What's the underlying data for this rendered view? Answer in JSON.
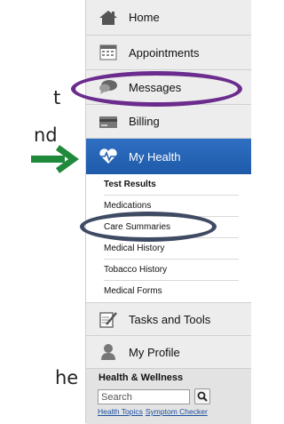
{
  "background_text": {
    "frag1": "t",
    "frag2": "nd",
    "frag3": "he"
  },
  "sidebar": {
    "items": [
      {
        "label": "Home",
        "icon": "home-icon"
      },
      {
        "label": "Appointments",
        "icon": "calendar-icon"
      },
      {
        "label": "Messages",
        "icon": "speech-bubble-icon"
      },
      {
        "label": "Billing",
        "icon": "billing-card-icon"
      },
      {
        "label": "My Health",
        "icon": "heart-pulse-icon"
      },
      {
        "label": "Tasks and Tools",
        "icon": "clipboard-pencil-icon"
      },
      {
        "label": "My Profile",
        "icon": "person-icon"
      }
    ],
    "health_submenu": [
      "Test Results",
      "Medications",
      "Care Summaries",
      "Medical History",
      "Tobacco History",
      "Medical Forms"
    ]
  },
  "health_wellness": {
    "title": "Health & Wellness",
    "search_value": "Search",
    "links": [
      "Health Topics",
      "Symptom Checker"
    ]
  },
  "colors": {
    "active_item": "#2563b0",
    "arrow": "#1f8a3b",
    "messages_highlight": "#6b2c8e",
    "care_summaries_highlight": "#3f4a63",
    "link": "#1a4fa0"
  }
}
